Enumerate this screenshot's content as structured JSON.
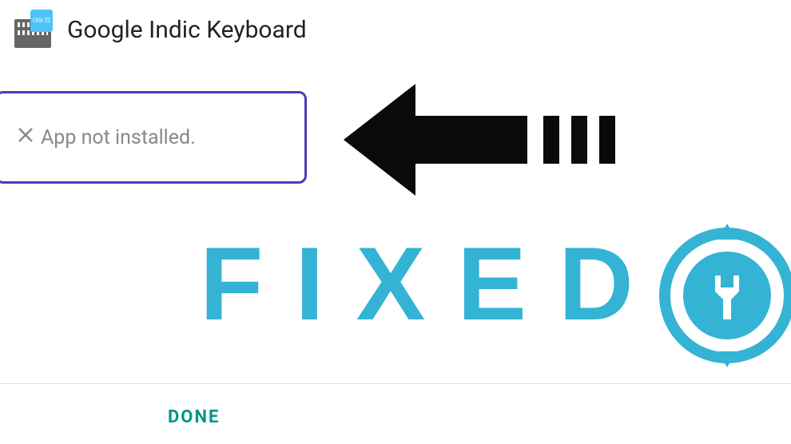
{
  "header": {
    "title": "Google Indic Keyboard",
    "icon_badge": "ଓଖ\nଅ"
  },
  "error": {
    "message": "App not installed."
  },
  "overlay": {
    "fixed_label": "FIXED"
  },
  "actions": {
    "done": "DONE"
  },
  "colors": {
    "accent_teal": "#009688",
    "fixed_blue": "#34b3d4",
    "border_purple": "#4a3db8"
  }
}
